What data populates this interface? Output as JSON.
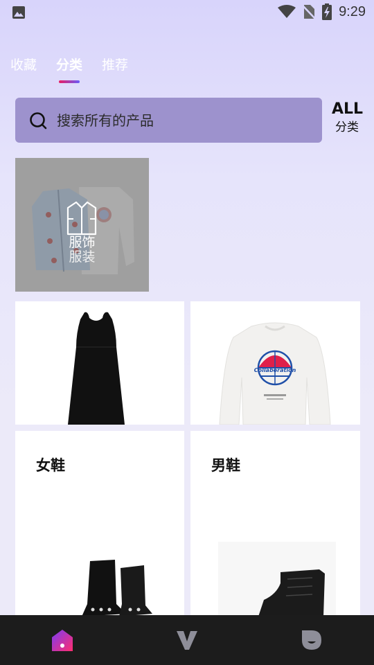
{
  "status": {
    "time": "9:29",
    "icons": [
      "image-icon",
      "wifi-icon",
      "no-sim-icon",
      "battery-charging-icon"
    ]
  },
  "tabs": [
    {
      "label": "收藏",
      "active": false
    },
    {
      "label": "分类",
      "active": true
    },
    {
      "label": "推荐",
      "active": false
    }
  ],
  "search": {
    "placeholder": "搜索所有的产品"
  },
  "all_button": {
    "label": "ALL",
    "sub_label": "分类"
  },
  "category_card": {
    "line1": "服饰",
    "line2": "服装",
    "icon": "shirt-icon"
  },
  "products": [
    {
      "name": "black-sleeveless-dress",
      "title": ""
    },
    {
      "name": "white-collaboration-sweatshirt",
      "title": ""
    },
    {
      "name": "womens-shoes",
      "title": "女鞋"
    },
    {
      "name": "mens-shoes",
      "title": "男鞋"
    }
  ],
  "sweatshirt_print": "Collaboration",
  "bottom_nav": [
    {
      "icon": "home-icon",
      "active": true
    },
    {
      "icon": "v-logo-icon",
      "active": false
    },
    {
      "icon": "profile-d-icon",
      "active": false
    }
  ],
  "colors": {
    "accent_pink": "#e91e63",
    "accent_purple": "#6a5af9",
    "search_bg": "#9d92cd",
    "nav_bg": "#1c1c1c"
  }
}
